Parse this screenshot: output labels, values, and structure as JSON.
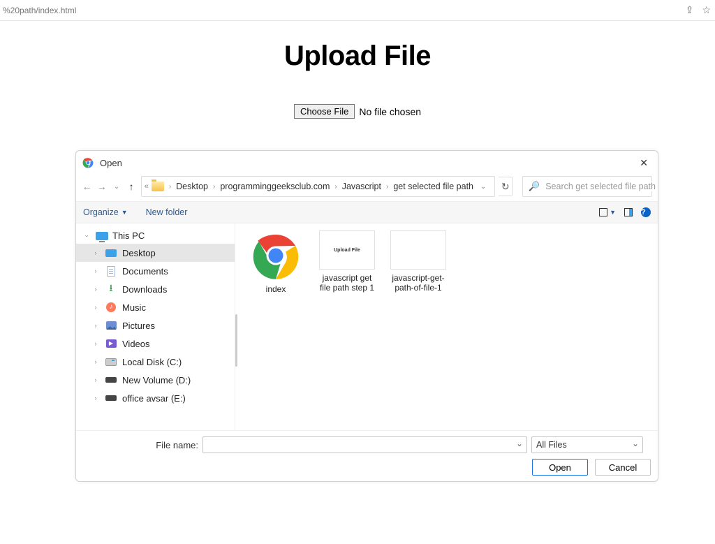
{
  "browser": {
    "url_fragment": "%20path/index.html"
  },
  "page": {
    "heading": "Upload File",
    "choose_button": "Choose File",
    "no_file_text": "No file chosen"
  },
  "dialog": {
    "title": "Open",
    "nav": {
      "breadcrumbs": [
        "Desktop",
        "programminggeeksclub.com",
        "Javascript",
        "get selected file path"
      ],
      "search_placeholder": "Search get selected file path"
    },
    "toolbar": {
      "organize": "Organize",
      "new_folder": "New folder"
    },
    "sidebar": {
      "root": "This PC",
      "items": [
        {
          "label": "Desktop",
          "icon": "desktop",
          "selected": true
        },
        {
          "label": "Documents",
          "icon": "documents"
        },
        {
          "label": "Downloads",
          "icon": "downloads"
        },
        {
          "label": "Music",
          "icon": "music"
        },
        {
          "label": "Pictures",
          "icon": "pictures"
        },
        {
          "label": "Videos",
          "icon": "videos"
        },
        {
          "label": "Local Disk (C:)",
          "icon": "disk"
        },
        {
          "label": "New Volume (D:)",
          "icon": "drive"
        },
        {
          "label": "office avsar (E:)",
          "icon": "drive"
        }
      ]
    },
    "files": [
      {
        "label": "index",
        "type": "chrome"
      },
      {
        "label": "javascript get file path step 1",
        "type": "thumb",
        "thumb_text": "Upload File"
      },
      {
        "label": "javascript-get-path-of-file-1",
        "type": "thumb",
        "thumb_text": ""
      }
    ],
    "footer": {
      "filename_label": "File name:",
      "filename_value": "",
      "filter": "All Files",
      "open": "Open",
      "cancel": "Cancel"
    }
  }
}
